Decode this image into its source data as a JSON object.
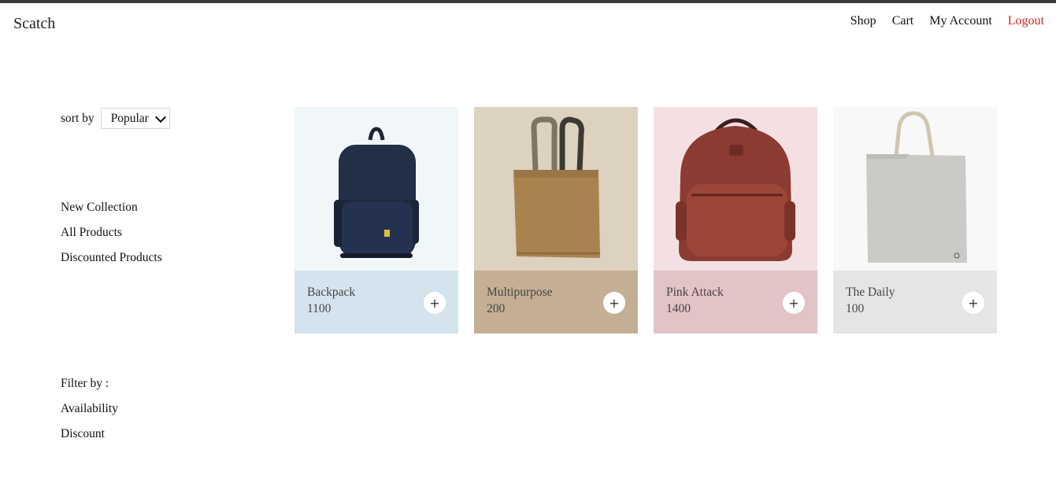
{
  "header": {
    "brand": "Scatch",
    "nav": {
      "shop": "Shop",
      "cart": "Cart",
      "account": "My Account",
      "logout": "Logout"
    }
  },
  "sidebar": {
    "sort_label": "sort by",
    "sort_selected": "Popular",
    "links": [
      "New Collection",
      "All Products",
      "Discounted Products"
    ],
    "filter_label": "Filter by :",
    "filters": [
      "Availability",
      "Discount"
    ]
  },
  "products": [
    {
      "name": "Backpack",
      "price": "1100",
      "image": "navy-backpack-image",
      "bg": "#f1f6f9",
      "panel": "#d4e3ed"
    },
    {
      "name": "Multipurpose",
      "price": "200",
      "image": "tan-tote-bag-image",
      "bg": "#ddd1bf",
      "panel": "#c5af94"
    },
    {
      "name": "Pink Attack",
      "price": "1400",
      "image": "leather-backpack-image",
      "bg": "#f4e0e2",
      "panel": "#e2c4c6"
    },
    {
      "name": "The Daily",
      "price": "100",
      "image": "canvas-tote-bag-image",
      "bg": "#f8f8f8",
      "panel": "#e5e5e5"
    }
  ],
  "add_symbol": "+",
  "colors": {
    "logout": "#d32626",
    "top_bar": "#3a3a3a"
  }
}
